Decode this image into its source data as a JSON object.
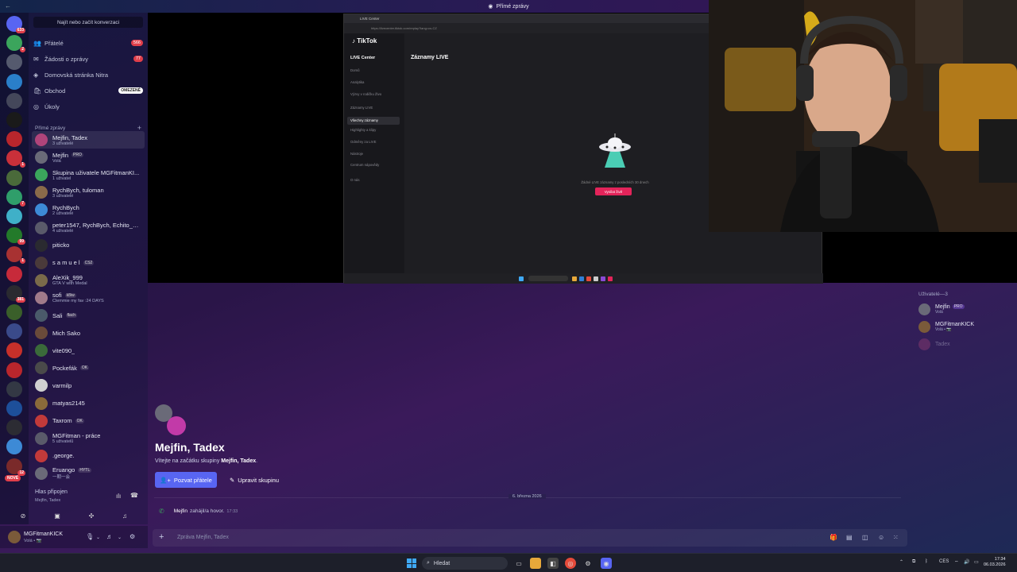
{
  "window": {
    "title": "Přímé zprávy"
  },
  "guilds": {
    "home_badge": "633",
    "servers": [
      {
        "color": "#5865f2",
        "badge": "633"
      },
      {
        "color": "#3ba55c",
        "badge": "2"
      },
      {
        "color": "#555a6e",
        "badge": ""
      },
      {
        "color": "#2a7fc9",
        "badge": ""
      },
      {
        "color": "#44475a",
        "badge": ""
      },
      {
        "color": "#1a1a1a",
        "badge": ""
      },
      {
        "color": "#b8262c",
        "badge": ""
      },
      {
        "color": "#c9303a",
        "badge": "1"
      },
      {
        "color": "#4a6a3a",
        "badge": ""
      },
      {
        "color": "#2f9e6a",
        "badge": "7"
      },
      {
        "color": "#3fb0c8",
        "badge": ""
      },
      {
        "color": "#237a2a",
        "badge": "99"
      },
      {
        "color": "#a83232",
        "badge": "1"
      },
      {
        "color": "#c72a3a",
        "badge": ""
      },
      {
        "color": "#2a2a30",
        "badge": "381"
      },
      {
        "color": "#3a5f2a",
        "badge": ""
      },
      {
        "color": "#3a4a8a",
        "badge": ""
      },
      {
        "color": "#c7302a",
        "badge": ""
      },
      {
        "color": "#b8262c",
        "badge": ""
      },
      {
        "color": "#333844",
        "badge": ""
      },
      {
        "color": "#1d4f9a",
        "badge": ""
      },
      {
        "color": "#2c2c33",
        "badge": ""
      },
      {
        "color": "#3d8ad6",
        "badge": ""
      },
      {
        "color": "#7a2a2a",
        "badge": "12"
      }
    ],
    "new_label": "NOVÉ"
  },
  "dm": {
    "search_placeholder": "Najít nebo začít konverzaci",
    "nav": [
      {
        "label": "Přátelé",
        "icon": "friends-icon",
        "count": "566"
      },
      {
        "label": "Žádosti o zprávy",
        "icon": "envelope-icon",
        "count": "77"
      },
      {
        "label": "Domovská stránka Nitra",
        "icon": "nitro-icon",
        "count": ""
      },
      {
        "label": "Obchod",
        "icon": "shop-icon",
        "tag": "OMEZENÉ"
      },
      {
        "label": "Úkoly",
        "icon": "quests-icon",
        "count": ""
      }
    ],
    "section_label": "Přímé zprávy",
    "conversations": [
      {
        "name": "Mejfin, Tadex",
        "status": "3 uživatelé",
        "chip": "",
        "color": "#b0447a",
        "selected": true
      },
      {
        "name": "Mejfin",
        "status": "Volá",
        "chip": "PRO",
        "color": "#6a6a78"
      },
      {
        "name": "Skupina uživatele MGFitmanKI...",
        "status": "1 uživatel",
        "chip": "",
        "color": "#3ba55c"
      },
      {
        "name": "RychBych, tuloman",
        "status": "3 uživatelé",
        "chip": "",
        "color": "#8a6a4a"
      },
      {
        "name": "RychBych",
        "status": "2 uživatelé",
        "chip": "",
        "color": "#3d8ad6"
      },
      {
        "name": "peter1547, RychBych, Echito_Ll...",
        "status": "4 uživatelé",
        "chip": "",
        "color": "#5a5a6a"
      },
      {
        "name": "piticko",
        "status": "",
        "chip": "",
        "color": "#2a2a30"
      },
      {
        "name": "s a m u e l",
        "status": "",
        "chip": "CS2",
        "color": "#4a3a3a"
      },
      {
        "name": "AleXik_999",
        "status": "GTA V with Medal",
        "chip": "",
        "color": "#7a6a4a"
      },
      {
        "name": "sofi",
        "status": "Clemmie my fav :24 DAYS",
        "chip": "k8iw",
        "color": "#a07a8a"
      },
      {
        "name": "Sali",
        "status": "",
        "chip": "flach",
        "color": "#4a5a6a"
      },
      {
        "name": "Mich Sako",
        "status": "",
        "chip": "",
        "color": "#6a4a3a"
      },
      {
        "name": "vite090_",
        "status": "",
        "chip": "",
        "color": "#3a6a3a"
      },
      {
        "name": "Pockefák",
        "status": "",
        "chip": "OK",
        "color": "#4a4a4a"
      },
      {
        "name": "varmilp",
        "status": "",
        "chip": "",
        "color": "#d0d0d0"
      },
      {
        "name": "matyas2145",
        "status": "",
        "chip": "",
        "color": "#8a6a3a"
      },
      {
        "name": "Taxrom",
        "status": "",
        "chip": "OK",
        "color": "#c23a3a"
      },
      {
        "name": "MGFitman - práce",
        "status": "5 uživatelů",
        "chip": "",
        "color": "#5a5a6a"
      },
      {
        "name": ".george.",
        "status": "",
        "chip": "",
        "color": "#c23a3a"
      },
      {
        "name": "Eruango",
        "status": "一期一会",
        "chip": "HYTL",
        "color": "#6a6a78"
      }
    ]
  },
  "voice": {
    "status": "Hlas připojen",
    "channel": "Mejfin, Tadex"
  },
  "user": {
    "name": "MGFitmanKICK",
    "status": "Volá • 📷"
  },
  "stream": {
    "tab": "LIVE Center",
    "url": "https://livecenter.tiktok.com/replay?lang=cs-CZ",
    "brand": "TikTok",
    "section": "LIVE Center",
    "page_title": "Záznamy LIVE",
    "menu": [
      {
        "label": "Domů",
        "selected": false
      },
      {
        "label": "Analytika",
        "selected": false
      },
      {
        "label": "Výzvy v rodičku Živo",
        "selected": false
      },
      {
        "label": "Záznamy LIVE",
        "selected": false
      },
      {
        "label": "Všechny záznamy",
        "selected": true
      },
      {
        "label": "Highlighty a klipy",
        "selected": false
      },
      {
        "label": "Odměny za LIVE",
        "selected": false
      },
      {
        "label": "Nástroje",
        "selected": false
      },
      {
        "label": "Centrum nápovědy",
        "selected": false
      },
      {
        "label": "O nás",
        "selected": false
      }
    ],
    "empty_text": "Žádné LIVE záznamy z posledních 30 dnech",
    "cta": "Vysílat živě"
  },
  "members": {
    "header": "Uživatelé—3",
    "list": [
      {
        "name": "Mejfin",
        "status": "Volá",
        "chip": "PRO",
        "color": "#6a6a78"
      },
      {
        "name": "MGFitmanKICK",
        "status": "Volá • 📷",
        "chip": "",
        "color": "#7a5a3a"
      },
      {
        "name": "Tadex",
        "status": "",
        "chip": "",
        "color": "#b0447a",
        "dim": true
      }
    ]
  },
  "chat": {
    "title": "Mejfin, Tadex",
    "welcome_prefix": "Vítejte na začátku skupiny ",
    "welcome_name": "Mejfin, Tadex",
    "welcome_suffix": ".",
    "invite_button": "Pozvat přátele",
    "edit_button": "Upravit skupinu",
    "date_divider": "6. března 2026",
    "call_user": "Mejfin",
    "call_text": "zahájil/a hovor.",
    "call_time": "17:33",
    "composer_placeholder": "Zpráva Mejfin, Tadex"
  },
  "taskbar": {
    "search": "Hledat",
    "lang": "CES",
    "time": "17:34",
    "date": "06.03.2026"
  }
}
